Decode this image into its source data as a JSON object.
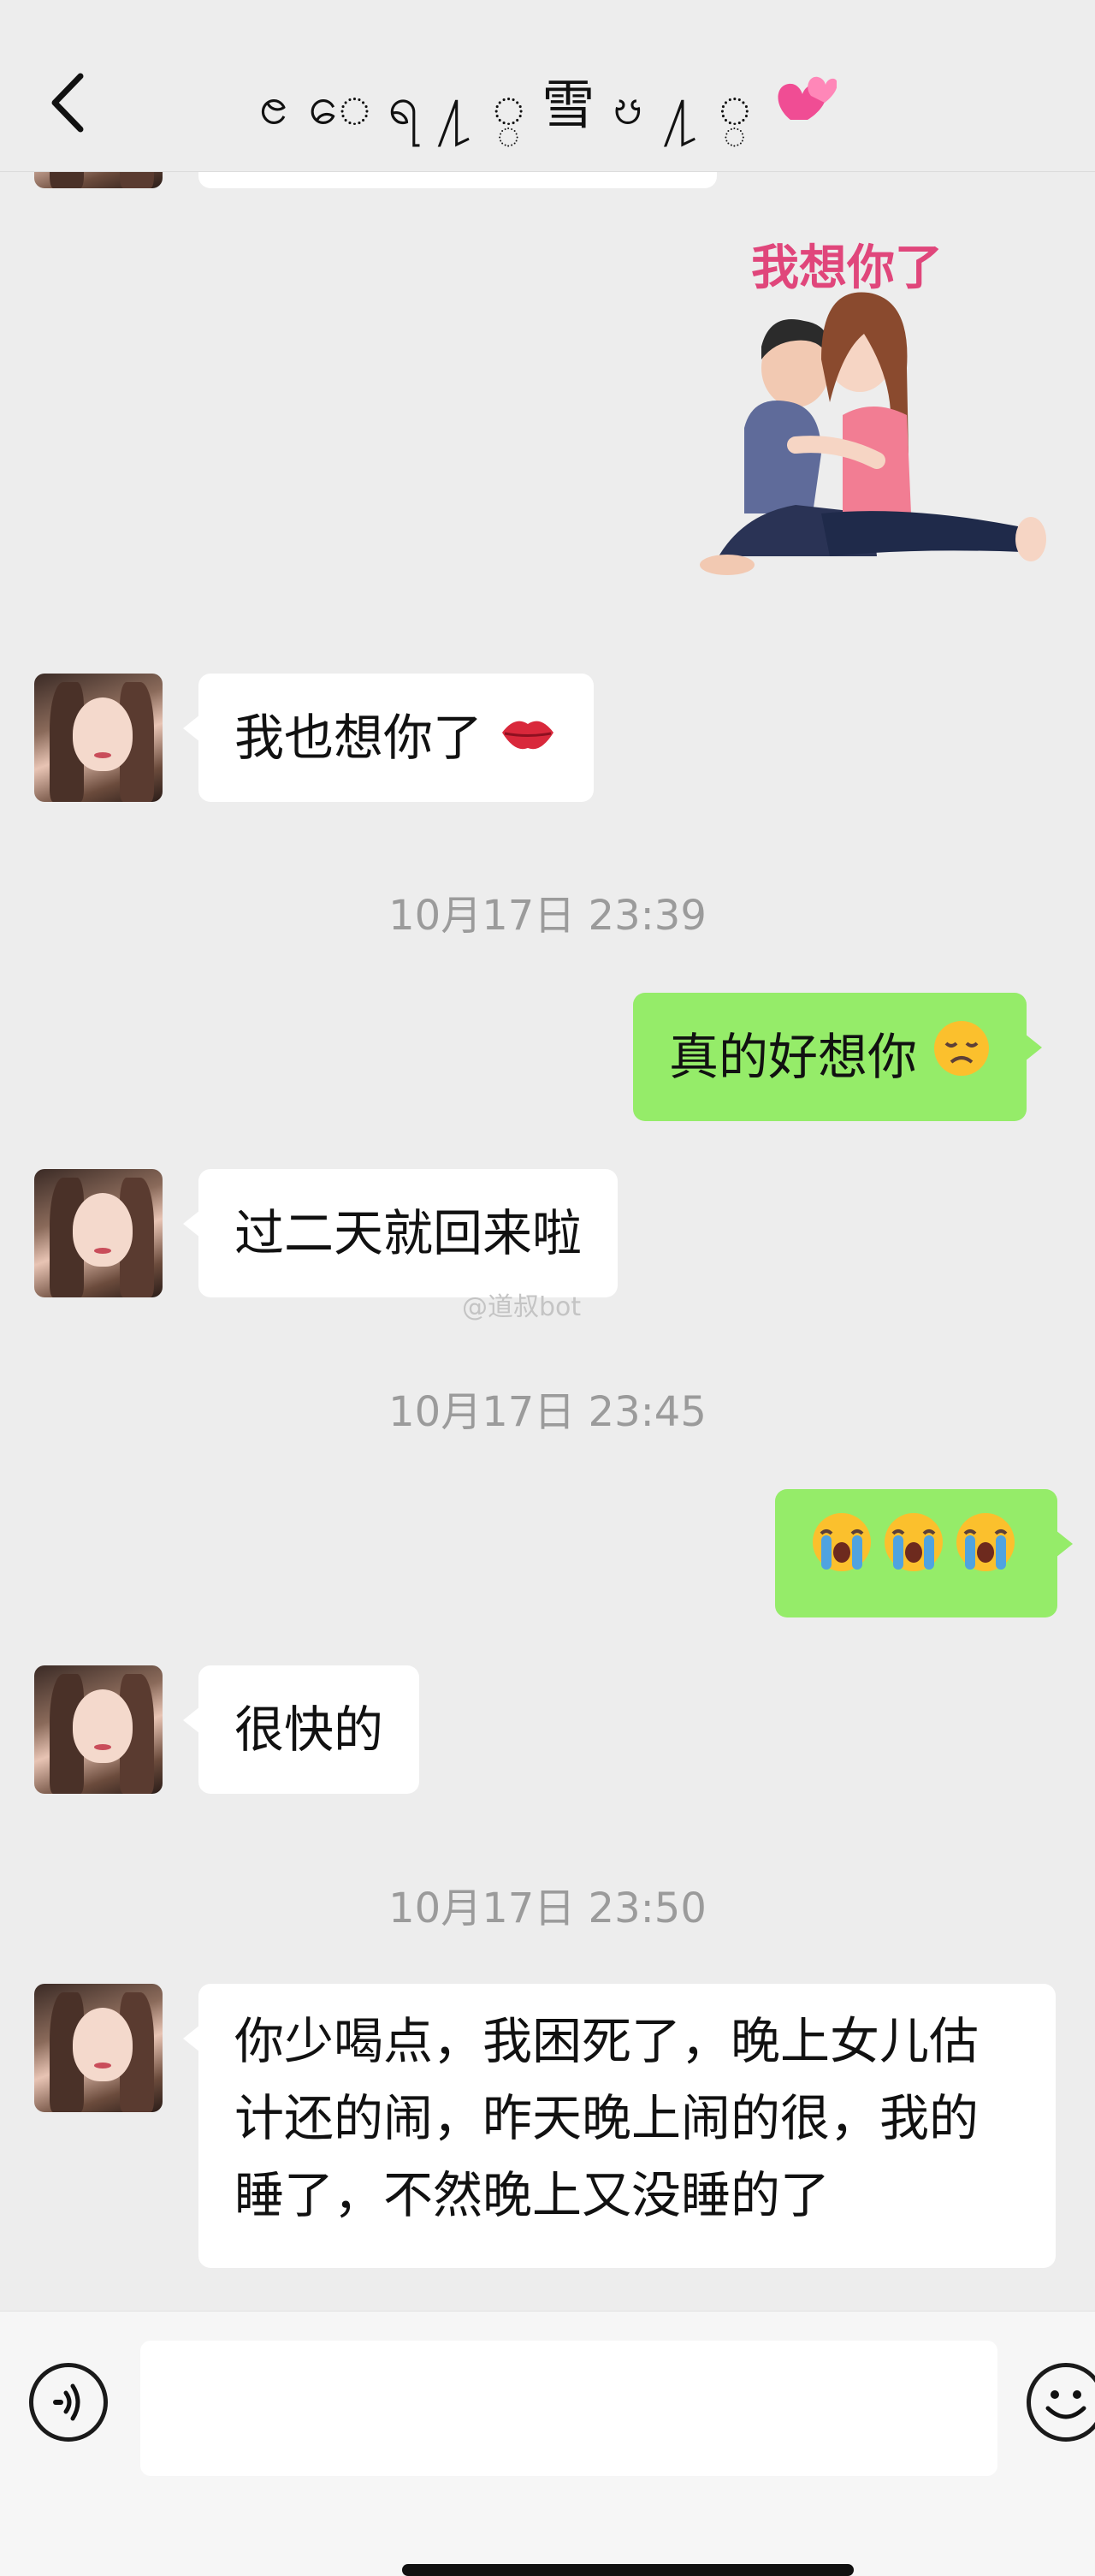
{
  "header": {
    "title": "ၔ ေ ရ ႔ ္ 雪 ၓ ႔ ္",
    "back_icon": "chevron-left-icon",
    "title_icon": "two-hearts-icon"
  },
  "sticker": {
    "caption": "我想你了",
    "icon": "kissing-couple-sticker"
  },
  "messages": [
    {
      "side": "left",
      "text": "我也想你了",
      "emoji": "kiss-mark-icon"
    },
    {
      "side": "right",
      "text": "真的好想你",
      "emoji": "disappointed-face-icon"
    },
    {
      "side": "left",
      "text": "过二天就回来啦"
    },
    {
      "side": "right",
      "text": "",
      "emoji": "loudly-crying-face-icon"
    },
    {
      "side": "left",
      "text": "很快的"
    },
    {
      "side": "left",
      "text": "你少喝点，我困死了，晚上女儿估计还的闹，昨天晚上闹的很，我的睡了，不然晚上又没睡的了"
    }
  ],
  "timestamps": [
    "10月17日 23:39",
    "10月17日 23:45",
    "10月17日 23:50"
  ],
  "watermark": "@道叔bot",
  "input": {
    "placeholder": ""
  },
  "colors": {
    "background": "#ededed",
    "incoming_bubble": "#ffffff",
    "outgoing_bubble": "#95ec69",
    "timestamp": "#9b9b9b"
  }
}
